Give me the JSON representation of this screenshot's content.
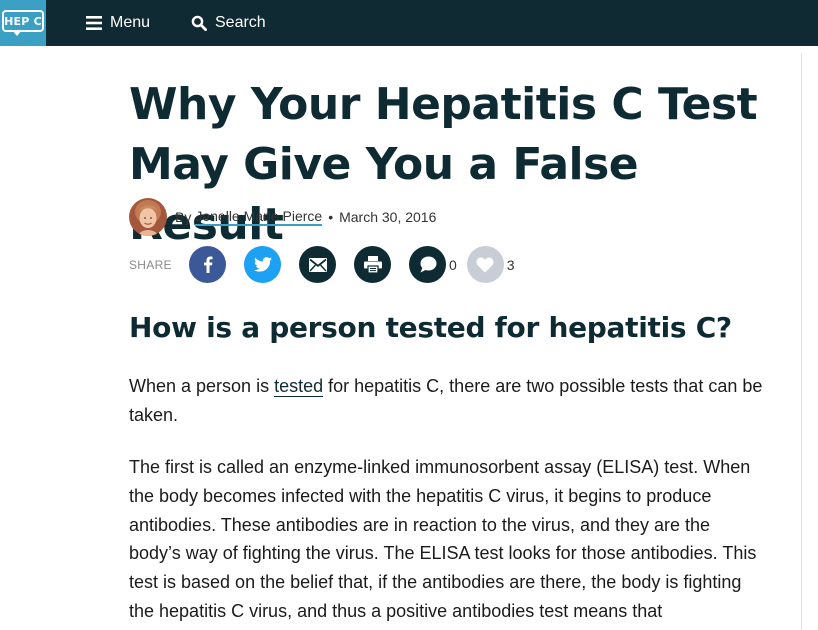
{
  "header": {
    "logo_text": "HEP C",
    "menu_label": "Menu",
    "search_label": "Search",
    "bg_color": "#102a33",
    "logo_color": "#3aa1c4"
  },
  "article": {
    "title": "Why Your Hepatitis C Test May Give You a False Result",
    "byline": {
      "by": "By",
      "author": "Jenelle Marie Pierce",
      "separator": "•",
      "date": "March 30, 2016"
    },
    "share": {
      "label": "SHARE",
      "buttons": [
        "facebook-icon",
        "twitter-icon",
        "email-icon",
        "print-icon",
        "comment-icon",
        "heart-icon"
      ],
      "comment_count": "0",
      "like_count": "3"
    },
    "subhead": "How is a person tested for hepatitis C?",
    "para1": {
      "before": "When a person is ",
      "link": "tested",
      "after": " for hepatitis C, there are two possible tests that can be taken."
    },
    "para2": "The first is called an enzyme-linked immunosorbent assay (ELISA) test. When the body becomes infected with the hepatitis C virus, it begins to produce antibodies. These antibodies are in reaction to the virus, and they are the body’s way of fighting the virus. The ELISA test looks for those antibodies. This test is based on the belief that, if the antibodies are there, the body is fighting the hepatitis C virus, and thus a positive antibodies test means that"
  }
}
